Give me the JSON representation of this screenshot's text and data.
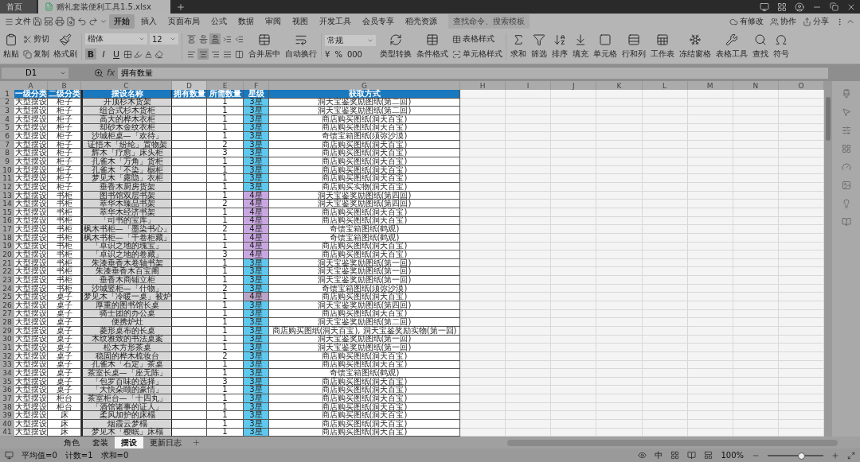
{
  "title_bar": {
    "tabs": [
      {
        "label": "首页",
        "selected": false
      },
      {
        "label": "赠礼套装便利工具1.5.xlsx",
        "selected": true
      }
    ]
  },
  "menu": {
    "file": "文件",
    "tabs": [
      {
        "label": "开始",
        "selected": true
      },
      {
        "label": "插入",
        "selected": false
      },
      {
        "label": "页面布局",
        "selected": false
      },
      {
        "label": "公式",
        "selected": false
      },
      {
        "label": "数据",
        "selected": false
      },
      {
        "label": "审阅",
        "selected": false
      },
      {
        "label": "视图",
        "selected": false
      },
      {
        "label": "开发工具",
        "selected": false
      },
      {
        "label": "会员专享",
        "selected": false
      },
      {
        "label": "稻壳资源",
        "selected": false
      }
    ],
    "search": {
      "placeholder": "查找命令、搜索模板"
    },
    "actions": [
      "有修改",
      "协作",
      "分享"
    ]
  },
  "ribbon": {
    "paste": "粘贴",
    "cut": "剪切",
    "copy": "复制",
    "painter": "格式刷",
    "font_family": "楷体",
    "font_size": "12",
    "font_buttons": [
      {
        "label": "B",
        "selected": true
      },
      {
        "label": "I",
        "selected": false
      },
      {
        "label": "U",
        "selected": false
      }
    ],
    "alignment": [
      {
        "selected": false
      },
      {
        "selected": false
      },
      {
        "selected": true
      },
      {
        "selected": false
      },
      {
        "selected": false
      },
      {
        "selected": false
      },
      {
        "selected": true
      },
      {
        "selected": false
      },
      {
        "selected": false
      },
      {
        "selected": false
      }
    ],
    "merge": "合并居中",
    "wrap": "自动换行",
    "number_format": "常规",
    "number_symbols": [
      "¥",
      "%",
      "000"
    ],
    "convert": "类型转换",
    "conditional": "条件格式",
    "table_style": "表格样式",
    "cell_style": "单元格样式",
    "tools": [
      "求和",
      "筛选",
      "排序",
      "填充",
      "单元格",
      "行和列",
      "工作表",
      "冻结窗格",
      "表格工具",
      "查找",
      "符号"
    ]
  },
  "formula_bar": {
    "cell": "D1",
    "fx": "fx",
    "value": "拥有数量"
  },
  "columns": [
    {
      "label": "A",
      "selected": false
    },
    {
      "label": "B",
      "selected": false
    },
    {
      "label": "C",
      "selected": false
    },
    {
      "label": "D",
      "selected": true
    },
    {
      "label": "E",
      "selected": false
    },
    {
      "label": "F",
      "selected": false
    },
    {
      "label": "G",
      "selected": false
    },
    {
      "label": "H",
      "selected": false
    },
    {
      "label": "I",
      "selected": false
    },
    {
      "label": "J",
      "selected": false
    },
    {
      "label": "K",
      "selected": false
    },
    {
      "label": "L",
      "selected": false
    },
    {
      "label": "M",
      "selected": false
    },
    {
      "label": "N",
      "selected": false
    },
    {
      "label": "O",
      "selected": false
    }
  ],
  "header": {
    "num": "1",
    "cells": [
      "一级分类",
      "二级分类",
      "摆设名称",
      "拥有数量",
      "所需数量",
      "星级",
      "获取方式"
    ]
  },
  "rows": [
    {
      "num": "2",
      "cells": [
        "大型摆设",
        "柜子",
        "开顶杉木货架",
        "1",
        "3星",
        "洞天宝鉴奖励图纸(第二回)"
      ],
      "color": "#5ec8ee"
    },
    {
      "num": "3",
      "cells": [
        "大型摆设",
        "柜子",
        "组合式杉木货柜",
        "1",
        "3星",
        "洞天宝鉴奖励图纸(第二回)"
      ],
      "color": "#5ec8ee"
    },
    {
      "num": "4",
      "cells": [
        "大型摆设",
        "柜子",
        "高大的桦木衣柜",
        "1",
        "3星",
        "商店购买图纸(洞天百宝)"
      ],
      "color": "#5ec8ee"
    },
    {
      "num": "5",
      "cells": [
        "大型摆设",
        "柜子",
        "却砂木金纹衣柜",
        "1",
        "3星",
        "商店购买图纸(洞天百宝)"
      ],
      "color": "#5ec8ee"
    },
    {
      "num": "6",
      "cells": [
        "大型摆设",
        "柜子",
        "沙城柜桌—「欢待」",
        "1",
        "3星",
        "奇馈宝箱图纸(须弥沙漠)"
      ],
      "color": "#5ec8ee"
    },
    {
      "num": "7",
      "cells": [
        "大型摆设",
        "柜子",
        "证悟木「纷纶」置物架",
        "2",
        "3星",
        "商店购买图纸(洞天百宝)"
      ],
      "color": "#5ec8ee"
    },
    {
      "num": "8",
      "cells": [
        "大型摆设",
        "柜子",
        "辉木「疗愈」床头柜",
        "3",
        "3星",
        "商店购买图纸(洞天百宝)"
      ],
      "color": "#5ec8ee"
    },
    {
      "num": "9",
      "cells": [
        "大型摆设",
        "柜子",
        "孔雀木「万角」货柜",
        "1",
        "3星",
        "商店购买图纸(洞天百宝)"
      ],
      "color": "#5ec8ee"
    },
    {
      "num": "10",
      "cells": [
        "大型摆设",
        "柜子",
        "孔雀木「不染」橱柜",
        "1",
        "3星",
        "商店购买图纸(洞天百宝)"
      ],
      "color": "#5ec8ee"
    },
    {
      "num": "11",
      "cells": [
        "大型摆设",
        "柜子",
        "梦见木「露隐」衣柜",
        "1",
        "3星",
        "商店购买图纸(洞天百宝)"
      ],
      "color": "#5ec8ee"
    },
    {
      "num": "12",
      "cells": [
        "大型摆设",
        "柜子",
        "垂香木厨房货架",
        "1",
        "3星",
        "商店购买实物(洞天百宝)"
      ],
      "color": "#5ec8ee"
    },
    {
      "num": "13",
      "cells": [
        "大型摆设",
        "书柜",
        "图书馆双层书架",
        "1",
        "4星",
        "洞天宝鉴奖励图纸(第四回)"
      ],
      "color": "#c9a8e2"
    },
    {
      "num": "14",
      "cells": [
        "大型摆设",
        "书柜",
        "萃华木臻品书架",
        "2",
        "4星",
        "洞天宝鉴奖励图纸(第四回)"
      ],
      "color": "#c9a8e2"
    },
    {
      "num": "15",
      "cells": [
        "大型摆设",
        "书柜",
        "萃华木经济书架",
        "1",
        "4星",
        "商店购买图纸(洞天百宝)"
      ],
      "color": "#c9a8e2"
    },
    {
      "num": "16",
      "cells": [
        "大型摆设",
        "书柜",
        "「司书的宝库」",
        "1",
        "4星",
        "商店购买图纸(洞天百宝)"
      ],
      "color": "#c9a8e2"
    },
    {
      "num": "17",
      "cells": [
        "大型摆设",
        "书柜",
        "枫木书柜—「墨染书心」",
        "2",
        "4星",
        "奇馈宝箱图纸(鹤观)"
      ],
      "color": "#c9a8e2"
    },
    {
      "num": "18",
      "cells": [
        "大型摆设",
        "书柜",
        "枫木书柜—「千卷柜藏」",
        "1",
        "4星",
        "奇馈宝箱图纸(鹤观)"
      ],
      "color": "#c9a8e2"
    },
    {
      "num": "19",
      "cells": [
        "大型摆设",
        "书柜",
        "「卓识之地的瑰宝」",
        "1",
        "4星",
        "商店购买图纸(洞天百宝)"
      ],
      "color": "#c9a8e2"
    },
    {
      "num": "20",
      "cells": [
        "大型摆设",
        "书柜",
        "「卓识之地的卷藏」",
        "3",
        "4星",
        "商店购买图纸(洞天百宝)"
      ],
      "color": "#c9a8e2"
    },
    {
      "num": "21",
      "cells": [
        "大型摆设",
        "书柜",
        "朱漆垂香木卷轴书架",
        "1",
        "3星",
        "洞天宝鉴奖励图纸(第一回)"
      ],
      "color": "#5ec8ee"
    },
    {
      "num": "22",
      "cells": [
        "大型摆设",
        "书柜",
        "朱漆垂香木百宝阁",
        "1",
        "3星",
        "洞天宝鉴奖励图纸(第一回)"
      ],
      "color": "#5ec8ee"
    },
    {
      "num": "23",
      "cells": [
        "大型摆设",
        "书柜",
        "垂香木商铺立柜",
        "1",
        "3星",
        "洞天宝鉴奖励图纸(第一回)"
      ],
      "color": "#5ec8ee"
    },
    {
      "num": "24",
      "cells": [
        "大型摆设",
        "书柜",
        "沙城竖柜—「什物」",
        "2",
        "3星",
        "奇馈宝箱图纸(须弥沙漠)"
      ],
      "color": "#5ec8ee"
    },
    {
      "num": "25",
      "cells": [
        "大型摆设",
        "桌子",
        "梦见木「冷暖一桌」被炉",
        "1",
        "4星",
        "商店购买图纸(洞天百宝)"
      ],
      "color": "#b9a5c8"
    },
    {
      "num": "26",
      "cells": [
        "大型摆设",
        "桌子",
        "厚重的图书馆长桌",
        "1",
        "3星",
        "洞天宝鉴奖励图纸(第四回)"
      ],
      "color": "#5ec8ee"
    },
    {
      "num": "27",
      "cells": [
        "大型摆设",
        "桌子",
        "骑士团的办公桌",
        "1",
        "3星",
        "商店购买图纸(洞天百宝)"
      ],
      "color": "#5ec8ee"
    },
    {
      "num": "28",
      "cells": [
        "大型摆设",
        "桌子",
        "便携炉灶",
        "1",
        "3星",
        "洞天宝鉴奖励图纸(第二回)"
      ],
      "color": "#5ec8ee"
    },
    {
      "num": "29",
      "cells": [
        "大型摆设",
        "桌子",
        "菱形桌布的长桌",
        "1",
        "3星",
        "商店购买图纸(洞天百宝), 洞天宝鉴奖励实物(第一回)"
      ],
      "color": "#5ec8ee"
    },
    {
      "num": "30",
      "cells": [
        "大型摆设",
        "桌子",
        "木纹雅致的书法桌案",
        "1",
        "3星",
        "洞天宝鉴奖励图纸(第一回)"
      ],
      "color": "#5ec8ee"
    },
    {
      "num": "31",
      "cells": [
        "大型摆设",
        "桌子",
        "松木方形茶桌",
        "1",
        "3星",
        "洞天宝鉴奖励图纸(第一回)"
      ],
      "color": "#5ec8ee"
    },
    {
      "num": "32",
      "cells": [
        "大型摆设",
        "桌子",
        "稳固的桦木梳妆台",
        "2",
        "3星",
        "商店购买图纸(洞天百宝)"
      ],
      "color": "#5ec8ee"
    },
    {
      "num": "33",
      "cells": [
        "大型摆设",
        "桌子",
        "孔雀木「石定」茶桌",
        "1",
        "3星",
        "商店购买图纸(洞天百宝)"
      ],
      "color": "#5ec8ee"
    },
    {
      "num": "34",
      "cells": [
        "大型摆设",
        "桌子",
        "茶室长桌—「座无陈」",
        "1",
        "3星",
        "奇馈宝箱图纸(鹤观)"
      ],
      "color": "#5ec8ee"
    },
    {
      "num": "35",
      "cells": [
        "大型摆设",
        "桌子",
        "「包罗百味的选择」",
        "3",
        "3星",
        "商店购买图纸(洞天百宝)"
      ],
      "color": "#5ec8ee"
    },
    {
      "num": "36",
      "cells": [
        "大型摆设",
        "桌子",
        "「大快朵颐的豪情」",
        "1",
        "3星",
        "商店购买图纸(洞天百宝)"
      ],
      "color": "#5ec8ee"
    },
    {
      "num": "37",
      "cells": [
        "大型摆设",
        "柜台",
        "茶室柜台—「十四丸」",
        "1",
        "3星",
        "商店购买图纸(洞天百宝)"
      ],
      "color": "#5ec8ee"
    },
    {
      "num": "38",
      "cells": [
        "大型摆设",
        "柜台",
        "「酒馆诸事的证人」",
        "1",
        "3星",
        "商店购买图纸(洞天百宝)"
      ],
      "color": "#5ec8ee"
    },
    {
      "num": "39",
      "cells": [
        "大型摆设",
        "床",
        "柔风加护的床榻",
        "1",
        "3星",
        "商店购买图纸(洞天百宝)"
      ],
      "color": "#5ec8ee"
    },
    {
      "num": "40",
      "cells": [
        "大型摆设",
        "床",
        "烟霞云梦榻",
        "1",
        "3星",
        "商店购买图纸(洞天百宝)"
      ],
      "color": "#5ec8ee"
    },
    {
      "num": "41",
      "cells": [
        "大型摆设",
        "床",
        "梦见木「樱眠」床榻",
        "1",
        "3星",
        "商店购买图纸(洞天百宝)"
      ],
      "color": "#5ec8ee"
    }
  ],
  "sheet_tabs": [
    {
      "label": "角色",
      "selected": false
    },
    {
      "label": "套装",
      "selected": false
    },
    {
      "label": "摆设",
      "selected": true
    },
    {
      "label": "更新日志",
      "selected": false
    }
  ],
  "status_bar": {
    "stats": [
      "平均值=0",
      "计数=1",
      "求和=0"
    ],
    "input_mode": "中",
    "zoom": {
      "label": "100%",
      "level": 0.6
    }
  }
}
